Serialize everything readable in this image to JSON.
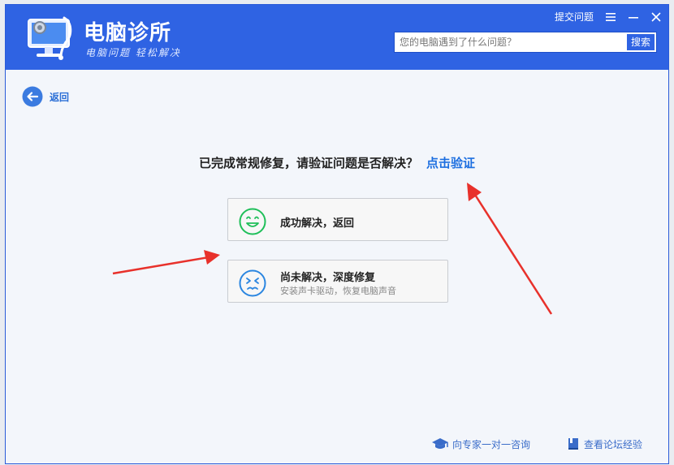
{
  "app": {
    "title": "电脑诊所",
    "subtitle": "电脑问题 轻松解决"
  },
  "titlebar": {
    "submit_link": "提交问题"
  },
  "search": {
    "placeholder": "您的电脑遇到了什么问题？",
    "button": "搜索"
  },
  "nav": {
    "back": "返回"
  },
  "prompt": {
    "question": "已完成常规修复，请验证问题是否解决？",
    "verify_link": "点击验证"
  },
  "options": [
    {
      "title": "成功解决，返回",
      "desc": "",
      "icon": "smile-icon",
      "color": "#1fbf59"
    },
    {
      "title": "尚未解决，深度修复",
      "desc": "安装声卡驱动，恢复电脑声音",
      "icon": "frown-icon",
      "color": "#2b86e0"
    }
  ],
  "footer": {
    "expert": "向专家一对一咨询",
    "forum": "查看论坛经验"
  },
  "colors": {
    "brand": "#2f63e3",
    "link": "#1d6fe0",
    "annotation_arrow": "#e8312b"
  }
}
